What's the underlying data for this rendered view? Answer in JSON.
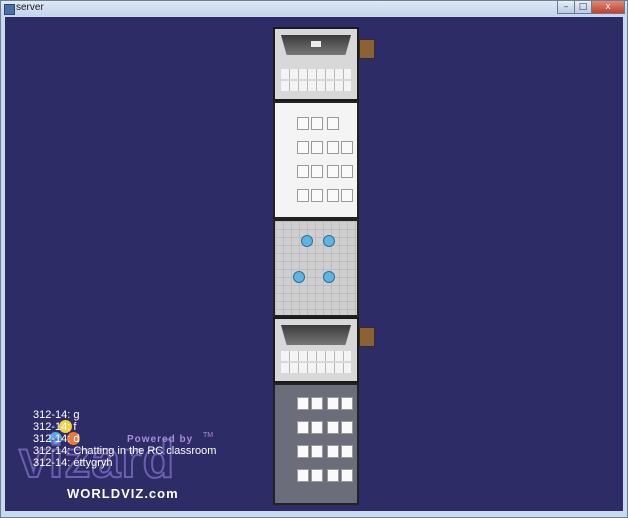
{
  "window": {
    "title": "server"
  },
  "controls": {
    "minimize": "–",
    "maximize": "□",
    "close": "x"
  },
  "console": [
    "312-14: g",
    "312-14: f",
    "312-14: d",
    "312-14: Chatting in the RC classroom",
    "312-14: ettygryh"
  ],
  "logo": {
    "powered": "Powered by",
    "tm": "TM",
    "word": "vizard",
    "site": "WORLDVIZ.com"
  },
  "colors": {
    "viewport_bg": "#2e2c66"
  }
}
